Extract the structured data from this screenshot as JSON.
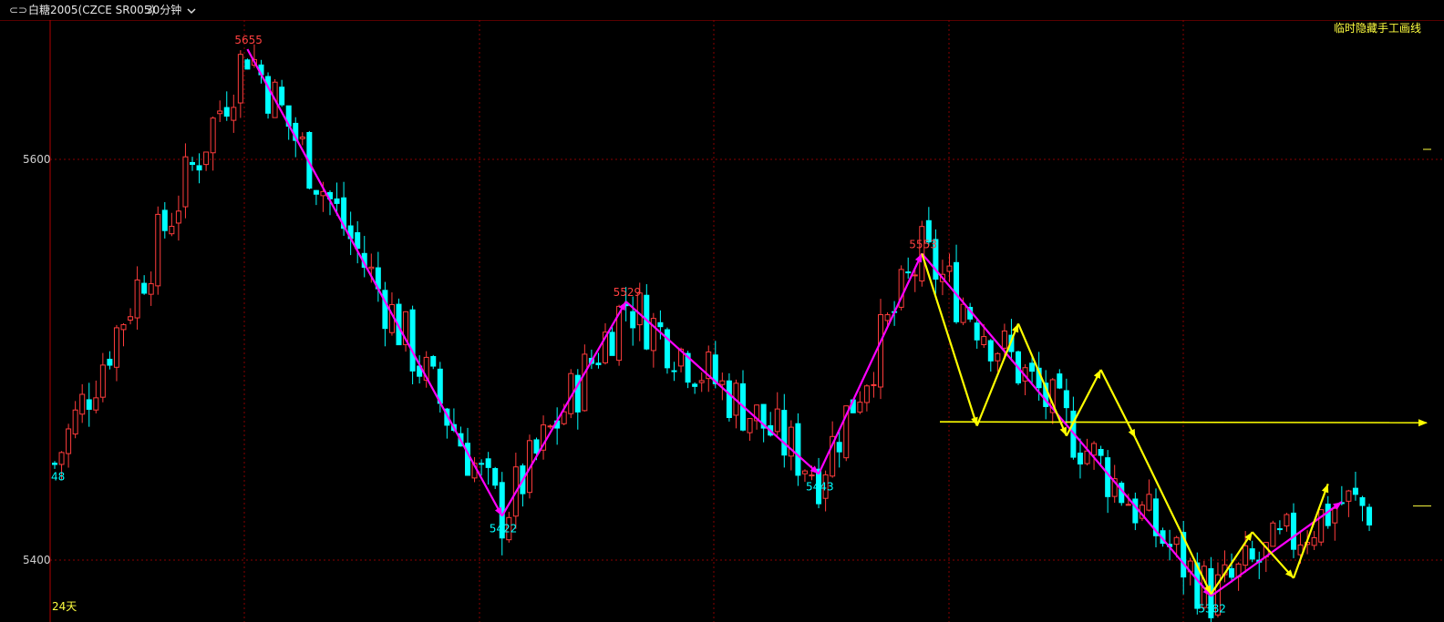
{
  "header": {
    "link_icon": "⊂⊃",
    "title": "白糖2005(CZCE SR005)",
    "period": "30分钟",
    "period_icon": "chevron-down-icon"
  },
  "toolbar": {
    "hide_drawings_label": "临时隐藏手工画线"
  },
  "footer": {
    "days_label": "24天"
  },
  "colors": {
    "background": "#000000",
    "up": "#ff3c3c",
    "down": "#00ffff",
    "zigzag_major": "#ff00ff",
    "zigzag_minor": "#ffff00",
    "grid": "#8a0000",
    "high_label": "#ff4040",
    "low_label": "#00ffff"
  },
  "chart_data": {
    "type": "candlestick",
    "instrument": "白糖2005(CZCE SR005)",
    "period": "30分钟",
    "yaxis": {
      "ticks": [
        5600,
        5400
      ],
      "range": [
        5383,
        5665
      ]
    },
    "grid": true,
    "pivots": [
      {
        "bar": 0,
        "price": 5448,
        "kind": "low",
        "label": "48"
      },
      {
        "bar": 28,
        "price": 5655,
        "kind": "high",
        "label": "5655"
      },
      {
        "bar": 65,
        "price": 5422,
        "kind": "low",
        "label": "5422"
      },
      {
        "bar": 83,
        "price": 5529,
        "kind": "high",
        "label": "5529"
      },
      {
        "bar": 111,
        "price": 5443,
        "kind": "low",
        "label": "5443"
      },
      {
        "bar": 126,
        "price": 5553,
        "kind": "high",
        "label": "5553"
      },
      {
        "bar": 168,
        "price": 5382,
        "kind": "low",
        "label": "5382"
      },
      {
        "bar": 187,
        "price": 5429,
        "kind": "high",
        "label": ""
      }
    ],
    "zigzag_major": [
      [
        28,
        5655
      ],
      [
        65,
        5422
      ],
      [
        83,
        5529
      ],
      [
        111,
        5443
      ],
      [
        126,
        5553
      ],
      [
        168,
        5382
      ],
      [
        187,
        5429
      ]
    ],
    "zigzag_minor": [
      [
        126,
        5553
      ],
      [
        134,
        5467
      ],
      [
        140,
        5518
      ],
      [
        147,
        5462
      ],
      [
        152,
        5495
      ],
      [
        157,
        5461
      ],
      [
        168,
        5383
      ],
      [
        174,
        5414
      ],
      [
        180,
        5391
      ],
      [
        185,
        5438
      ]
    ],
    "horizontal_line": 5469
  }
}
